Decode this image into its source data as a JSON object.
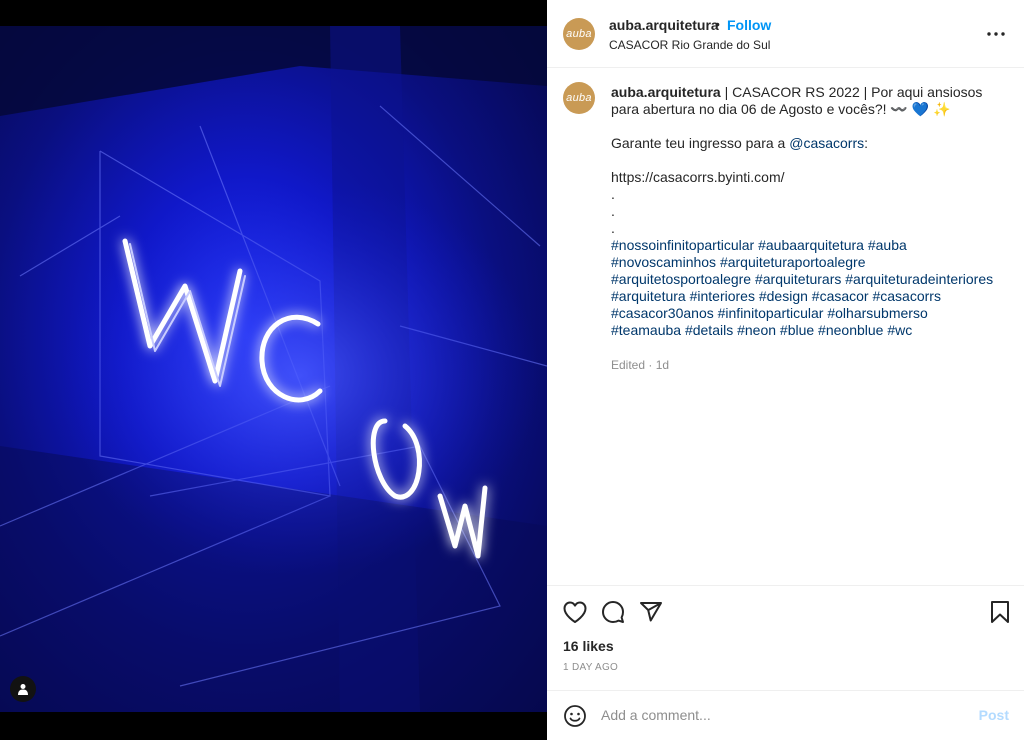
{
  "post": {
    "username": "auba.arquitetura",
    "avatar_text": "auba",
    "separator": "•",
    "follow_label": "Follow",
    "location": "CASACOR Rio Grande do Sul",
    "neon_text": "WC",
    "caption": {
      "title": "| CASACOR RS 2022 | Por aqui ansiosos para abertura no dia 06 de Agosto e vocês?! 〰️ 💙 ✨",
      "line2_prefix": "Garante teu ingresso para a ",
      "mention": "@casacorrs",
      "line2_suffix": ":",
      "url": "https://casacorrs.byinti.com/",
      "dots": [
        ".",
        ".",
        "."
      ],
      "hashtags": "#nossoinfinitoparticular #aubaarquitetura #auba #novoscaminhos #arquiteturaportoalegre #arquitetosportoalegre #arquiteturars #arquiteturadeinteriores #arquitetura #interiores #design #casacor #casacorrs #casacor30anos #infinitoparticular #olharsubmerso #teamauba #details #neon #blue #neonblue #wc"
    },
    "edited": "Edited · 1d",
    "likes": "16 likes",
    "time_ago": "1 DAY AGO",
    "comment_placeholder": "Add a comment...",
    "post_label": "Post"
  },
  "icons": {
    "more": "more-options-icon",
    "like": "heart-icon",
    "comment": "comment-icon",
    "share": "share-icon",
    "save": "bookmark-icon",
    "emoji": "emoji-icon",
    "tag": "user-tag-icon"
  },
  "colors": {
    "follow": "#0095f6",
    "avatar": "#c99a55",
    "post_disabled": "#b3dbff",
    "neon": "#ffffff",
    "background_blue": "#1018c8"
  }
}
